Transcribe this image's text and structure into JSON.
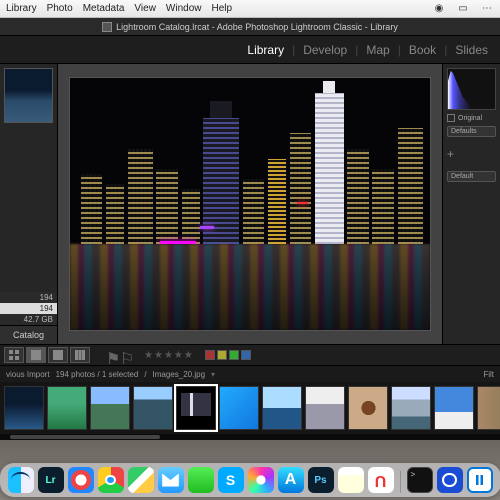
{
  "mac_menu": {
    "items": [
      "Library",
      "Photo",
      "Metadata",
      "View",
      "Window",
      "Help"
    ]
  },
  "window": {
    "title": "Lightroom Catalog.lrcat - Adobe Photoshop Lightroom Classic - Library"
  },
  "modules": {
    "items": [
      "Library",
      "Develop",
      "Map",
      "Book",
      "Slides"
    ],
    "active": "Library"
  },
  "left": {
    "count_a": "194",
    "count_b": "194",
    "size": "42.7 GB",
    "catalog_label": "Catalog"
  },
  "right": {
    "original_label": "Original",
    "defaults_a": "Defaults",
    "defaults_b": "Default",
    "plus": "+"
  },
  "filmstrip": {
    "source_label": "vious Import",
    "count_text": "194 photos / 1 selected",
    "filename": "Images_20.jpg",
    "filter_label": "Filt"
  },
  "dock": {
    "apps": [
      "finder",
      "lightroom",
      "safari",
      "chrome",
      "maps",
      "mail",
      "messages",
      "skype",
      "itunes",
      "appstore",
      "photoshop",
      "notes",
      "magnet",
      "terminal",
      "1password",
      "pause"
    ]
  }
}
